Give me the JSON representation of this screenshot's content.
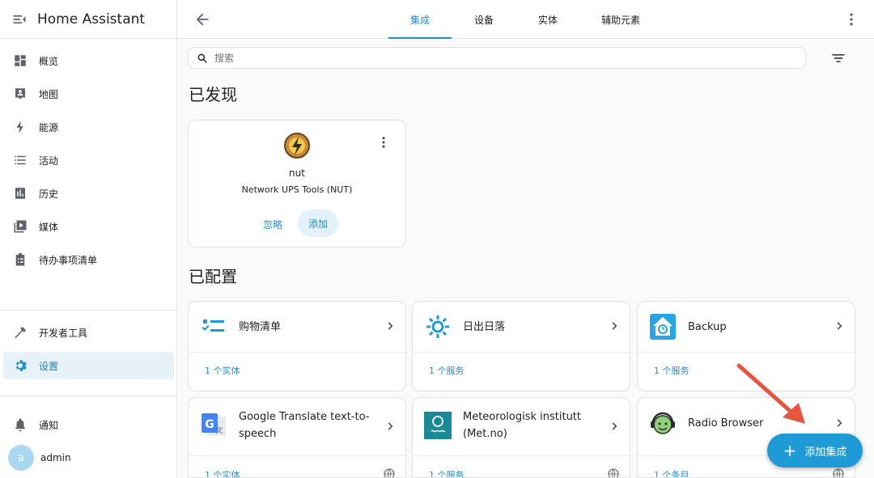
{
  "app": {
    "title": "Home Assistant"
  },
  "sidebar": {
    "items": [
      {
        "label": "概览",
        "icon": "dashboard-icon"
      },
      {
        "label": "地图",
        "icon": "map-icon"
      },
      {
        "label": "能源",
        "icon": "lightning-icon"
      },
      {
        "label": "活动",
        "icon": "list-icon"
      },
      {
        "label": "历史",
        "icon": "chart-icon"
      },
      {
        "label": "媒体",
        "icon": "media-icon"
      },
      {
        "label": "待办事项清单",
        "icon": "clipboard-icon"
      }
    ],
    "developer_tools": "开发者工具",
    "settings": "设置",
    "notifications": "通知",
    "user": {
      "initial": "a",
      "name": "admin"
    }
  },
  "topbar": {
    "tabs": [
      {
        "label": "集成",
        "active": true
      },
      {
        "label": "设备",
        "active": false
      },
      {
        "label": "实体",
        "active": false
      },
      {
        "label": "辅助元素",
        "active": false
      }
    ]
  },
  "search": {
    "placeholder": "搜索"
  },
  "discovered": {
    "title": "已发现",
    "card": {
      "name": "nut",
      "description": "Network UPS Tools (NUT)",
      "ignore_label": "忽略",
      "add_label": "添加"
    }
  },
  "configured": {
    "title": "已配置",
    "cards": [
      {
        "name": "购物清单",
        "footer": "1 个实体",
        "icon": "shopping-list-icon"
      },
      {
        "name": "日出日落",
        "footer": "1 个服务",
        "icon": "sun-icon"
      },
      {
        "name": "Backup",
        "footer": "1 个服务",
        "icon": "backup-icon"
      },
      {
        "name": "Google Translate text-to-speech",
        "footer": "1 个实体",
        "icon": "google-translate-icon"
      },
      {
        "name": "Meteorologisk institutt (Met.no)",
        "footer": "1 个服务",
        "icon": "met-no-icon"
      },
      {
        "name": "Radio Browser",
        "footer": "1 个条目",
        "icon": "radio-browser-icon"
      }
    ]
  },
  "fab": {
    "label": "添加集成"
  },
  "colors": {
    "accent": "#1f8fd0",
    "fab": "#1e9ad6",
    "annotation_arrow": "#e8553e"
  }
}
